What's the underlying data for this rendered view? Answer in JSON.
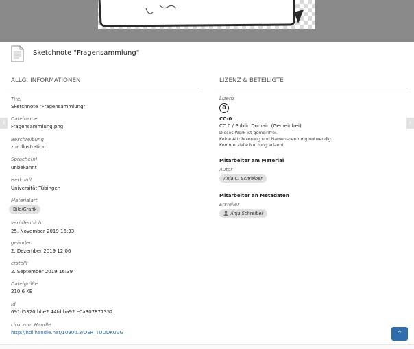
{
  "title": "Sketchnote \"Fragensammlung\"",
  "left_section": {
    "heading": "ALLG. INFORMATIONEN",
    "fields": {
      "titel": {
        "label": "Titel",
        "value": "Sketchnote \"Fragensammlung\""
      },
      "dateiname": {
        "label": "Dateiname",
        "value": "Fragensammlung.png"
      },
      "beschreibung": {
        "label": "Beschreibung",
        "value": "zur Illustration"
      },
      "sprache": {
        "label": "Sprache(n)",
        "value": "unbekannt"
      },
      "herkunft": {
        "label": "Herkunft",
        "value": "Universität Tübingen"
      },
      "materialart": {
        "label": "Materialart",
        "value": "Bild/Grafik"
      },
      "veroeffentlicht": {
        "label": "veröffentlicht",
        "value": "25. November 2019 16:33"
      },
      "geaendert": {
        "label": "geändert",
        "value": "2. Dezember 2019 12:06"
      },
      "erstellt": {
        "label": "erstellt",
        "value": "2. September 2019 16:39"
      },
      "dateigroesse": {
        "label": "Dateigröße",
        "value": "210,6 KB"
      },
      "id": {
        "label": "Id",
        "value": "691d5320 bbe2 44fd ba92 e0a307877352"
      },
      "link": {
        "label": "Link zum Handle",
        "value": "http://hdl.handle.net/10900.3/OER_TUDDKUVG"
      }
    }
  },
  "right_section": {
    "heading": "LIZENZ & BETEILIGTE",
    "lizenz_label": "Lizenz",
    "cc_symbol": "0",
    "license_short": "CC-0",
    "license_name": "CC 0 / Public Domain (Gemeinfrei)",
    "license_desc_1": "Dieses Werk ist gemeinfrei.",
    "license_desc_2": "Keine Attribuierung und Namensnennung notwendig.",
    "license_desc_3": "Kommerzielle Nutzung erlaubt.",
    "material_heading": "Mitarbeiter am Material",
    "author_label": "Autor",
    "author_name": "Anja C. Schreiber",
    "metadata_heading": "Mitarbeiter an Metadaten",
    "creator_label": "Ersteller",
    "creator_name": "Anja Schreiber"
  },
  "icons": {
    "left_arrow": "‹",
    "right_arrow": "›",
    "up_arrow": "⌃"
  }
}
